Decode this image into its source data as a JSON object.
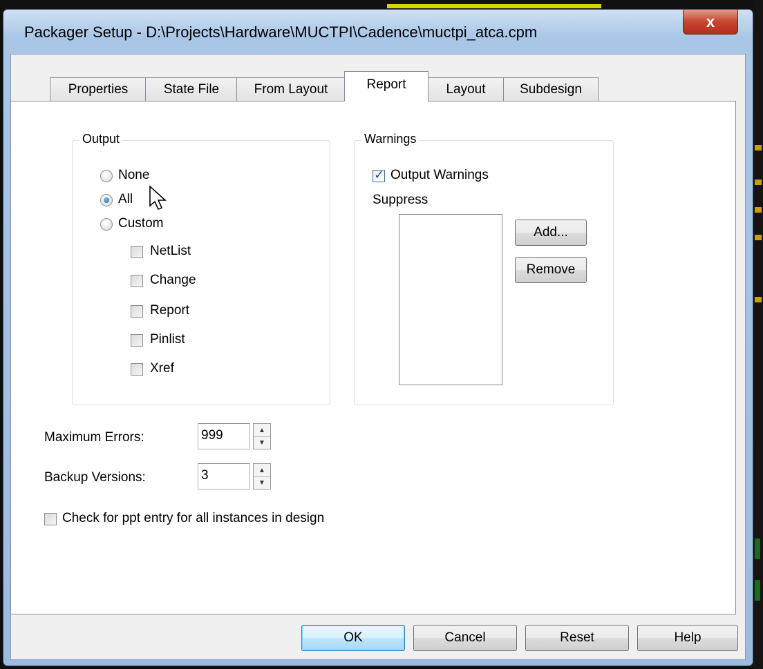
{
  "window": {
    "title": "Packager Setup - D:\\Projects\\Hardware\\MUCTPI\\Cadence\\muctpi_atca.cpm",
    "close_glyph": "x"
  },
  "tabs": [
    {
      "label": "Properties"
    },
    {
      "label": "State File"
    },
    {
      "label": "From Layout"
    },
    {
      "label": "Report"
    },
    {
      "label": "Layout"
    },
    {
      "label": "Subdesign"
    }
  ],
  "active_tab": "Report",
  "output": {
    "title": "Output",
    "radios": [
      {
        "label": "None",
        "checked": false
      },
      {
        "label": "All",
        "checked": true
      },
      {
        "label": "Custom",
        "checked": false
      }
    ],
    "checkboxes": [
      {
        "label": "NetList",
        "checked": false
      },
      {
        "label": "Change",
        "checked": false
      },
      {
        "label": "Report",
        "checked": false
      },
      {
        "label": "Pinlist",
        "checked": false
      },
      {
        "label": "Xref",
        "checked": false
      }
    ]
  },
  "warnings": {
    "title": "Warnings",
    "output_warnings_label": "Output Warnings",
    "output_warnings_checked": true,
    "suppress_label": "Suppress",
    "add_label": "Add...",
    "remove_label": "Remove"
  },
  "max_errors": {
    "label": "Maximum Errors:",
    "value": "999"
  },
  "backup_versions": {
    "label": "Backup Versions:",
    "value": "3"
  },
  "check_ppt": {
    "label": "Check for ppt entry for all instances in design",
    "checked": false
  },
  "footer": {
    "ok_label": "OK",
    "cancel_label": "Cancel",
    "reset_label": "Reset",
    "help_label": "Help"
  }
}
